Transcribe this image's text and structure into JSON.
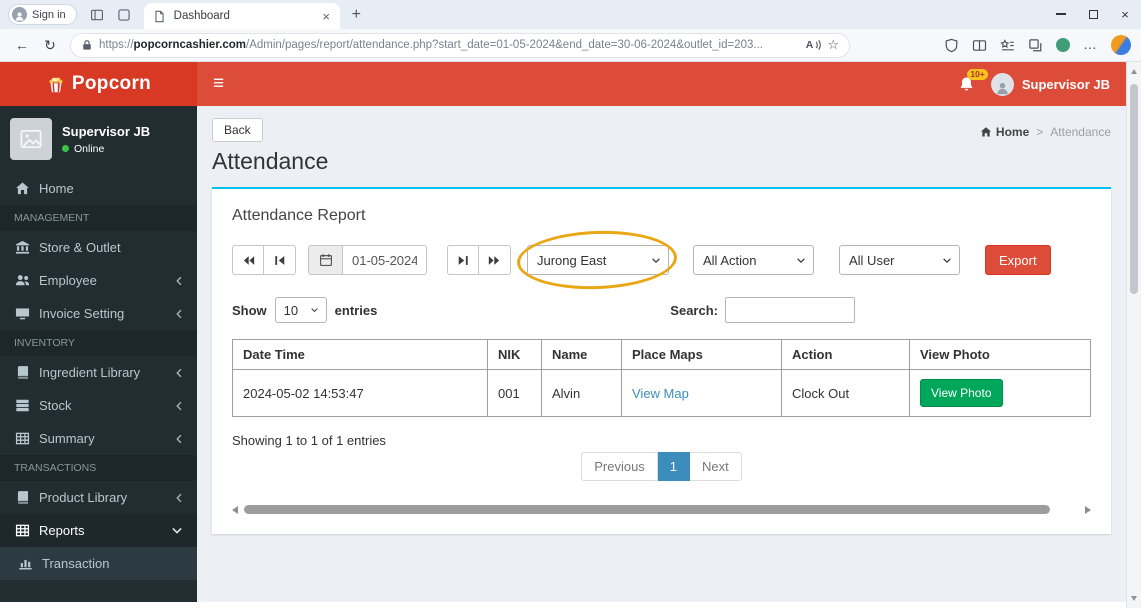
{
  "browser": {
    "signin_label": "Sign in",
    "tab_title": "Dashboard",
    "url_protocol": "https://",
    "url_domain": "popcorncashier.com",
    "url_path": "/Admin/pages/report/attendance.php?start_date=01-05-2024&end_date=30-06-2024&outlet_id=203...",
    "read_aloud_label": "A"
  },
  "icons": {
    "back_arrow": "←",
    "refresh": "↻",
    "star": "☆",
    "more": "…",
    "close": "×",
    "new_tab": "+",
    "hamburger": "≡",
    "breadcrumb_separator": ">"
  },
  "header": {
    "brand": "Popcorn",
    "notification_badge": "10+",
    "user_name": "Supervisor JB"
  },
  "sidebar": {
    "user_name": "Supervisor JB",
    "user_status": "Online",
    "items": [
      {
        "type": "item",
        "icon": "home-icon",
        "label": "Home"
      },
      {
        "type": "header",
        "label": "MANAGEMENT"
      },
      {
        "type": "item",
        "icon": "bank-icon",
        "label": "Store & Outlet"
      },
      {
        "type": "item",
        "icon": "users-icon",
        "label": "Employee",
        "chevron": "left"
      },
      {
        "type": "item",
        "icon": "screen-icon",
        "label": "Invoice Setting",
        "chevron": "left"
      },
      {
        "type": "header",
        "label": "INVENTORY"
      },
      {
        "type": "item",
        "icon": "book-icon",
        "label": "Ingredient Library",
        "chevron": "left"
      },
      {
        "type": "item",
        "icon": "stack-icon",
        "label": "Stock",
        "chevron": "left"
      },
      {
        "type": "item",
        "icon": "table-icon",
        "label": "Summary",
        "chevron": "left"
      },
      {
        "type": "header",
        "label": "TRANSACTIONS"
      },
      {
        "type": "item",
        "icon": "book-icon",
        "label": "Product Library",
        "chevron": "left"
      },
      {
        "type": "item",
        "icon": "table-icon",
        "label": "Reports",
        "chevron": "down",
        "active": true
      },
      {
        "type": "subitem",
        "icon": "bar-chart-icon",
        "label": "Transaction"
      }
    ]
  },
  "page": {
    "back_label": "Back",
    "title": "Attendance",
    "breadcrumb_home": "Home",
    "breadcrumb_current": "Attendance"
  },
  "report": {
    "title": "Attendance Report",
    "date_value": "01-05-2024",
    "outlet_selected": "Jurong East",
    "action_selected": "All Action",
    "user_selected": "All User",
    "export_label": "Export"
  },
  "datatable": {
    "show_label": "Show",
    "length_value": "10",
    "entries_label": "entries",
    "search_label": "Search:",
    "headers": [
      "Date Time",
      "NIK",
      "Name",
      "Place Maps",
      "Action",
      "View Photo"
    ],
    "rows": [
      {
        "date_time": "2024-05-02 14:53:47",
        "nik": "001",
        "name": "Alvin",
        "place_maps": "View Map",
        "action": "Clock Out",
        "view_photo": "View Photo"
      }
    ],
    "info": "Showing 1 to 1 of 1 entries",
    "prev_label": "Previous",
    "current_page": "1",
    "next_label": "Next"
  },
  "colors": {
    "header_red": "#dd4b39",
    "logo_red": "#d73925",
    "sidebar_dark": "#222d32",
    "accent_blue": "#3c8dbc",
    "box_top_blue": "#00c0ef",
    "success_green": "#00a65a",
    "export_red": "#dd4b39",
    "badge_yellow": "#f8c31c",
    "annotation_yellow": "#eaa714"
  }
}
